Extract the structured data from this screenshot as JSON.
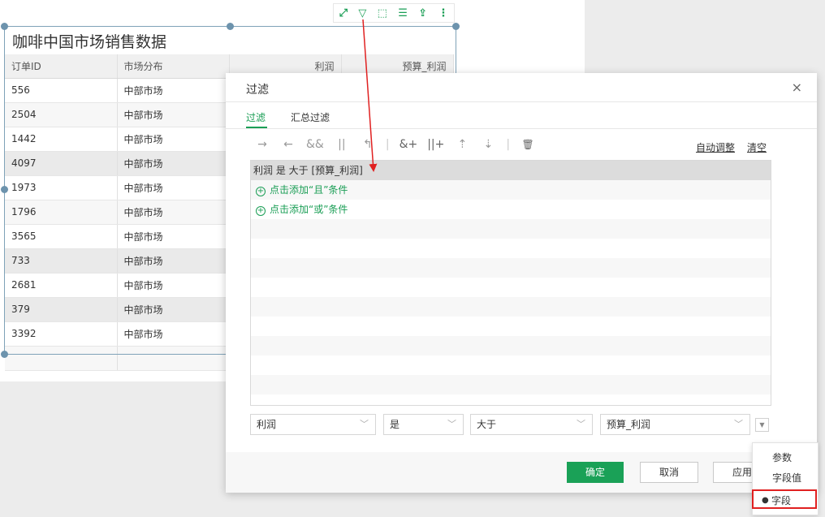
{
  "report": {
    "title": "咖啡中国市场销售数据",
    "columns": [
      "订单ID",
      "市场分布",
      "利润",
      "预算_利润"
    ],
    "rows": [
      [
        "556",
        "中部市场"
      ],
      [
        "2504",
        "中部市场"
      ],
      [
        "1442",
        "中部市场"
      ],
      [
        "4097",
        "中部市场"
      ],
      [
        "1973",
        "中部市场"
      ],
      [
        "1796",
        "中部市场"
      ],
      [
        "3565",
        "中部市场"
      ],
      [
        "733",
        "中部市场"
      ],
      [
        "2681",
        "中部市场"
      ],
      [
        "379",
        "中部市场"
      ],
      [
        "3392",
        "中部市场"
      ],
      [
        "",
        ""
      ]
    ],
    "toolbar_icons": [
      "expand-icon",
      "filter-icon",
      "select-icon",
      "list-icon",
      "export-icon",
      "more-icon"
    ]
  },
  "dialog": {
    "title": "过滤",
    "close": "×",
    "tabs": [
      "过滤",
      "汇总过滤"
    ],
    "toolbar_icons": [
      {
        "name": "move-right-icon",
        "glyph": "→"
      },
      {
        "name": "move-left-icon",
        "glyph": "←"
      },
      {
        "name": "and-icon",
        "glyph": "&&"
      },
      {
        "name": "or-icon",
        "glyph": "||"
      },
      {
        "name": "undo-icon",
        "glyph": "↰"
      },
      {
        "name": "add-and-icon",
        "glyph": "&+"
      },
      {
        "name": "add-or-icon",
        "glyph": "||+"
      },
      {
        "name": "move-up-icon",
        "glyph": "⇡"
      },
      {
        "name": "move-down-icon",
        "glyph": "⇣"
      },
      {
        "name": "delete-icon",
        "glyph": "🗑"
      }
    ],
    "auto_adjust": "自动调整",
    "clear": "清空",
    "condition": "利润 是 大于 [预算_利润]",
    "add_and": "点击添加“且”条件",
    "add_or": "点击添加“或”条件",
    "selects": [
      "利润",
      "是",
      "大于",
      "预算_利润"
    ],
    "buttons": {
      "ok": "确定",
      "cancel": "取消",
      "apply": "应用"
    }
  },
  "menu": {
    "items": [
      "参数",
      "字段值",
      "字段"
    ],
    "selected": "字段"
  },
  "colors": {
    "accent": "#1aa157",
    "annotation": "#e02020"
  }
}
